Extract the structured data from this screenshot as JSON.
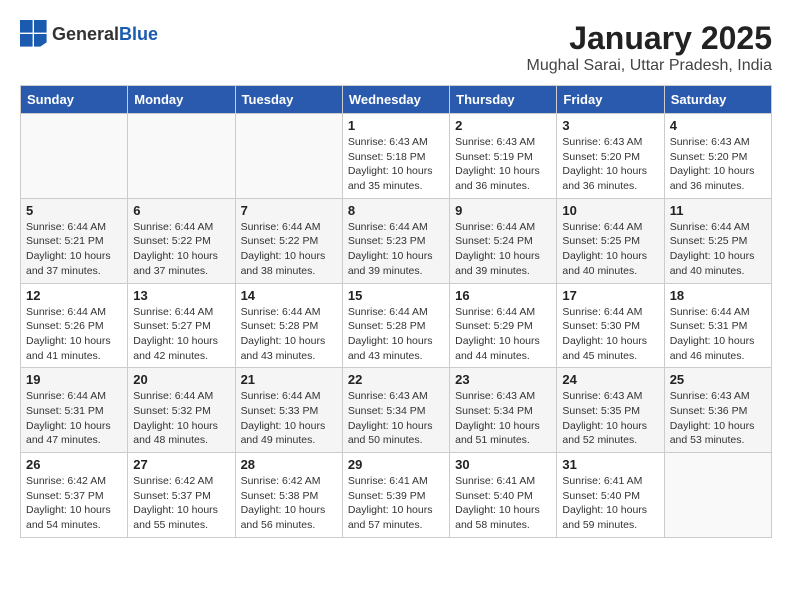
{
  "header": {
    "logo_general": "General",
    "logo_blue": "Blue",
    "title": "January 2025",
    "subtitle": "Mughal Sarai, Uttar Pradesh, India"
  },
  "days_of_week": [
    "Sunday",
    "Monday",
    "Tuesday",
    "Wednesday",
    "Thursday",
    "Friday",
    "Saturday"
  ],
  "weeks": [
    [
      {
        "day": "",
        "info": ""
      },
      {
        "day": "",
        "info": ""
      },
      {
        "day": "",
        "info": ""
      },
      {
        "day": "1",
        "info": "Sunrise: 6:43 AM\nSunset: 5:18 PM\nDaylight: 10 hours and 35 minutes."
      },
      {
        "day": "2",
        "info": "Sunrise: 6:43 AM\nSunset: 5:19 PM\nDaylight: 10 hours and 36 minutes."
      },
      {
        "day": "3",
        "info": "Sunrise: 6:43 AM\nSunset: 5:20 PM\nDaylight: 10 hours and 36 minutes."
      },
      {
        "day": "4",
        "info": "Sunrise: 6:43 AM\nSunset: 5:20 PM\nDaylight: 10 hours and 36 minutes."
      }
    ],
    [
      {
        "day": "5",
        "info": "Sunrise: 6:44 AM\nSunset: 5:21 PM\nDaylight: 10 hours and 37 minutes."
      },
      {
        "day": "6",
        "info": "Sunrise: 6:44 AM\nSunset: 5:22 PM\nDaylight: 10 hours and 37 minutes."
      },
      {
        "day": "7",
        "info": "Sunrise: 6:44 AM\nSunset: 5:22 PM\nDaylight: 10 hours and 38 minutes."
      },
      {
        "day": "8",
        "info": "Sunrise: 6:44 AM\nSunset: 5:23 PM\nDaylight: 10 hours and 39 minutes."
      },
      {
        "day": "9",
        "info": "Sunrise: 6:44 AM\nSunset: 5:24 PM\nDaylight: 10 hours and 39 minutes."
      },
      {
        "day": "10",
        "info": "Sunrise: 6:44 AM\nSunset: 5:25 PM\nDaylight: 10 hours and 40 minutes."
      },
      {
        "day": "11",
        "info": "Sunrise: 6:44 AM\nSunset: 5:25 PM\nDaylight: 10 hours and 40 minutes."
      }
    ],
    [
      {
        "day": "12",
        "info": "Sunrise: 6:44 AM\nSunset: 5:26 PM\nDaylight: 10 hours and 41 minutes."
      },
      {
        "day": "13",
        "info": "Sunrise: 6:44 AM\nSunset: 5:27 PM\nDaylight: 10 hours and 42 minutes."
      },
      {
        "day": "14",
        "info": "Sunrise: 6:44 AM\nSunset: 5:28 PM\nDaylight: 10 hours and 43 minutes."
      },
      {
        "day": "15",
        "info": "Sunrise: 6:44 AM\nSunset: 5:28 PM\nDaylight: 10 hours and 43 minutes."
      },
      {
        "day": "16",
        "info": "Sunrise: 6:44 AM\nSunset: 5:29 PM\nDaylight: 10 hours and 44 minutes."
      },
      {
        "day": "17",
        "info": "Sunrise: 6:44 AM\nSunset: 5:30 PM\nDaylight: 10 hours and 45 minutes."
      },
      {
        "day": "18",
        "info": "Sunrise: 6:44 AM\nSunset: 5:31 PM\nDaylight: 10 hours and 46 minutes."
      }
    ],
    [
      {
        "day": "19",
        "info": "Sunrise: 6:44 AM\nSunset: 5:31 PM\nDaylight: 10 hours and 47 minutes."
      },
      {
        "day": "20",
        "info": "Sunrise: 6:44 AM\nSunset: 5:32 PM\nDaylight: 10 hours and 48 minutes."
      },
      {
        "day": "21",
        "info": "Sunrise: 6:44 AM\nSunset: 5:33 PM\nDaylight: 10 hours and 49 minutes."
      },
      {
        "day": "22",
        "info": "Sunrise: 6:43 AM\nSunset: 5:34 PM\nDaylight: 10 hours and 50 minutes."
      },
      {
        "day": "23",
        "info": "Sunrise: 6:43 AM\nSunset: 5:34 PM\nDaylight: 10 hours and 51 minutes."
      },
      {
        "day": "24",
        "info": "Sunrise: 6:43 AM\nSunset: 5:35 PM\nDaylight: 10 hours and 52 minutes."
      },
      {
        "day": "25",
        "info": "Sunrise: 6:43 AM\nSunset: 5:36 PM\nDaylight: 10 hours and 53 minutes."
      }
    ],
    [
      {
        "day": "26",
        "info": "Sunrise: 6:42 AM\nSunset: 5:37 PM\nDaylight: 10 hours and 54 minutes."
      },
      {
        "day": "27",
        "info": "Sunrise: 6:42 AM\nSunset: 5:37 PM\nDaylight: 10 hours and 55 minutes."
      },
      {
        "day": "28",
        "info": "Sunrise: 6:42 AM\nSunset: 5:38 PM\nDaylight: 10 hours and 56 minutes."
      },
      {
        "day": "29",
        "info": "Sunrise: 6:41 AM\nSunset: 5:39 PM\nDaylight: 10 hours and 57 minutes."
      },
      {
        "day": "30",
        "info": "Sunrise: 6:41 AM\nSunset: 5:40 PM\nDaylight: 10 hours and 58 minutes."
      },
      {
        "day": "31",
        "info": "Sunrise: 6:41 AM\nSunset: 5:40 PM\nDaylight: 10 hours and 59 minutes."
      },
      {
        "day": "",
        "info": ""
      }
    ]
  ]
}
